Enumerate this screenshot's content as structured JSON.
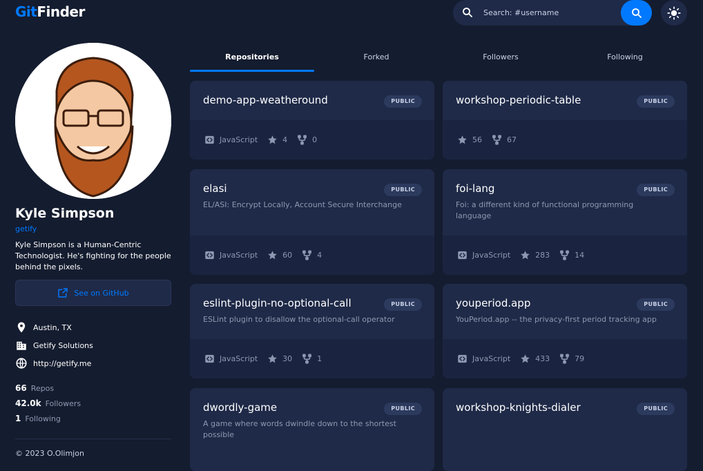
{
  "app": {
    "logo_part1": "Git",
    "logo_part2": "Finder"
  },
  "search": {
    "placeholder": "Search: #username"
  },
  "profile": {
    "name": "Kyle Simpson",
    "handle": "getify",
    "bio": "Kyle Simpson is a Human-Centric Technologist. He's fighting for the people behind the pixels.",
    "github_button": "See on GitHub",
    "location": "Austin, TX",
    "company": "Getify Solutions",
    "website": "http://getify.me",
    "stats": [
      {
        "num": "66",
        "label": "Repos"
      },
      {
        "num": "42.0k",
        "label": "Followers"
      },
      {
        "num": "1",
        "label": "Following"
      }
    ],
    "copyright": "© 2023 O.Olimjon"
  },
  "tabs": [
    "Repositories",
    "Forked",
    "Followers",
    "Following"
  ],
  "repos": [
    {
      "name": "demo-app-weatheround",
      "badge": "PUBLIC",
      "desc": "",
      "lang": "JavaScript",
      "stars": "4",
      "forks": "0"
    },
    {
      "name": "workshop-periodic-table",
      "badge": "PUBLIC",
      "desc": "",
      "lang": "",
      "stars": "56",
      "forks": "67"
    },
    {
      "name": "elasi",
      "badge": "PUBLIC",
      "desc": "EL/ASI: Encrypt Locally, Account Secure Interchange",
      "lang": "JavaScript",
      "stars": "60",
      "forks": "4"
    },
    {
      "name": "foi-lang",
      "badge": "PUBLIC",
      "desc": "Foi: a different kind of functional programming language",
      "lang": "JavaScript",
      "stars": "283",
      "forks": "14"
    },
    {
      "name": "eslint-plugin-no-optional-call",
      "badge": "PUBLIC",
      "desc": "ESLint plugin to disallow the optional-call operator",
      "lang": "JavaScript",
      "stars": "30",
      "forks": "1"
    },
    {
      "name": "youperiod.app",
      "badge": "PUBLIC",
      "desc": "YouPeriod.app -- the privacy-first period tracking app",
      "lang": "JavaScript",
      "stars": "433",
      "forks": "79"
    },
    {
      "name": "dwordly-game",
      "badge": "PUBLIC",
      "desc": "A game where words dwindle down to the shortest possible",
      "lang": "",
      "stars": "",
      "forks": ""
    },
    {
      "name": "workshop-knights-dialer",
      "badge": "PUBLIC",
      "desc": "",
      "lang": "",
      "stars": "",
      "forks": ""
    }
  ],
  "colors": {
    "accent": "#0079ff",
    "bg": "#141c2f",
    "card": "#1f2a48"
  }
}
